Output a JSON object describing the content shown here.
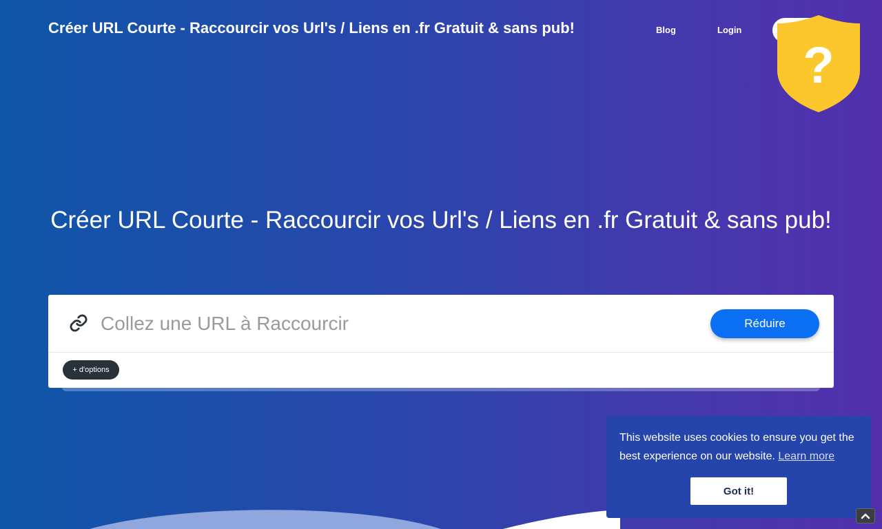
{
  "header": {
    "brand": "Créer URL Courte - Raccourcir vos Url's / Liens en .fr Gratuit & sans pub!",
    "nav": {
      "blog": "Blog",
      "login": "Login"
    }
  },
  "shield_badge": {
    "icon": "question-shield-icon",
    "color": "#fcc62d",
    "glyph": "?"
  },
  "hero": {
    "title": "Créer URL Courte - Raccourcir vos Url's / Liens en .fr Gratuit & sans pub!"
  },
  "shortener": {
    "icon": "link-icon",
    "placeholder": "Collez une URL à Raccourcir",
    "submit_label": "Réduire",
    "options_label": "+ d'options"
  },
  "cookie_banner": {
    "message": "This website uses cookies to ensure you get the best experience on our website.",
    "learn_more": "Learn more",
    "accept": "Got it!"
  },
  "colors": {
    "accent": "#0a6ff2",
    "background_start": "#0e56a8",
    "background_end": "#5230ad",
    "cookie_bg": "#2545ad"
  },
  "scroll_top": {
    "icon": "chevron-up-icon"
  }
}
